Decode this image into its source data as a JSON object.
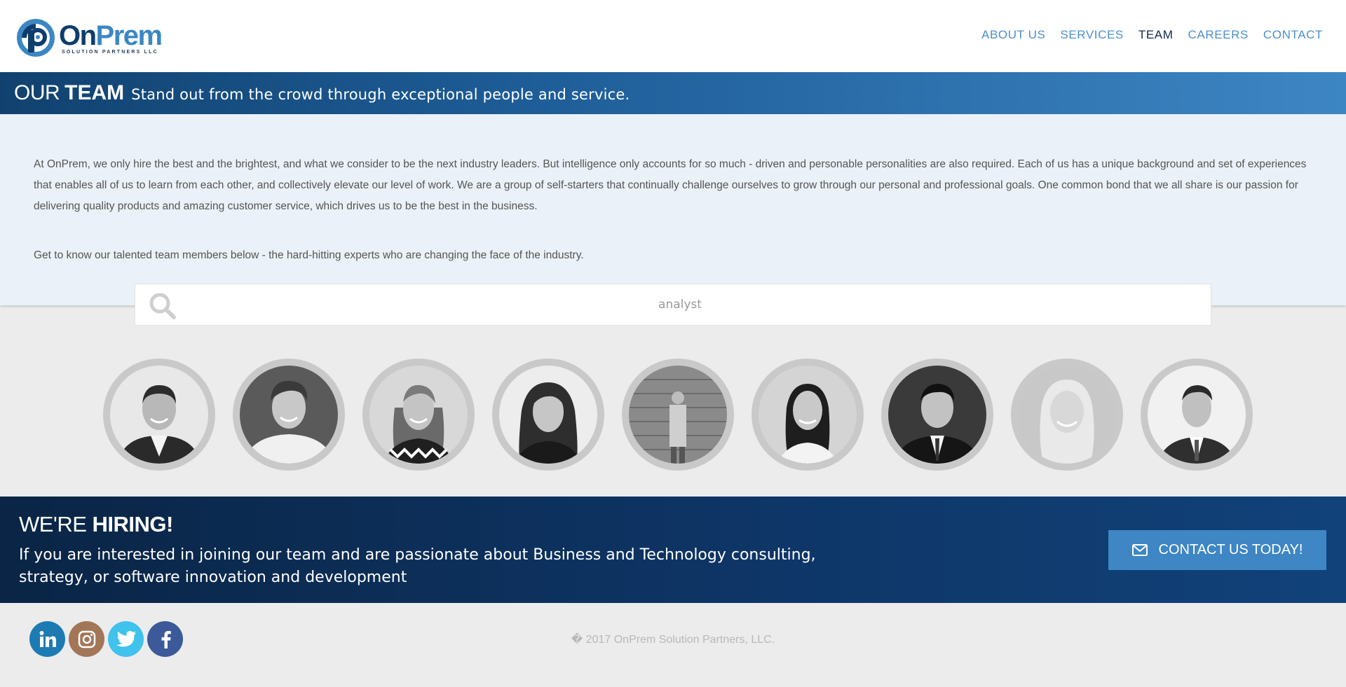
{
  "header": {
    "logo": {
      "name_part1": "On",
      "name_part2": "Prem",
      "tagline": "SOLUTION PARTNERS LLC"
    },
    "nav": [
      {
        "label": "ABOUT US",
        "active": false
      },
      {
        "label": "SERVICES",
        "active": false
      },
      {
        "label": "TEAM",
        "active": true
      },
      {
        "label": "CAREERS",
        "active": false
      },
      {
        "label": "CONTACT",
        "active": false
      }
    ]
  },
  "titlebar": {
    "light": "OUR",
    "bold": "TEAM",
    "subtitle": "Stand out from the crowd through exceptional people and service."
  },
  "intro": {
    "paragraph1": "At OnPrem, we only hire the best and the brightest, and what we consider to be the next industry leaders. But intelligence only accounts for so much - driven and personable personalities are also required. Each of us has a unique background and set of experiences that enables all of us to learn from each other, and collectively elevate our level of work. We are a group of self-starters that continually challenge ourselves to grow through our personal and professional goals. One common bond that we all share is our passion for delivering quality products and amazing customer service, which drives us to be the best in the business.",
    "paragraph2": "Get to know our talented team members below - the hard-hitting experts who are changing the face of the industry."
  },
  "search": {
    "value": "analyst",
    "placeholder": ""
  },
  "team": {
    "count": 9
  },
  "hiring": {
    "title_light": "WE'RE",
    "title_bold": "HIRING!",
    "text": "If you are interested in joining our team and are passionate about Business and Technology consulting, strategy, or software innovation and development",
    "cta_label": "CONTACT US TODAY!"
  },
  "footer": {
    "social": [
      {
        "icon": "linkedin-icon",
        "color": "#1e7ab3"
      },
      {
        "icon": "instagram-icon",
        "color": "#a37658"
      },
      {
        "icon": "twitter-icon",
        "color": "#3fc2ec"
      },
      {
        "icon": "facebook-icon",
        "color": "#3c5a9a"
      }
    ],
    "copyright": "� 2017 OnPrem Solution Partners, LLC."
  },
  "colors": {
    "brand_dark": "#0e3d6e",
    "brand_light": "#3b87c4",
    "nav": "#4c8fcb",
    "cta": "#3e86c4"
  }
}
